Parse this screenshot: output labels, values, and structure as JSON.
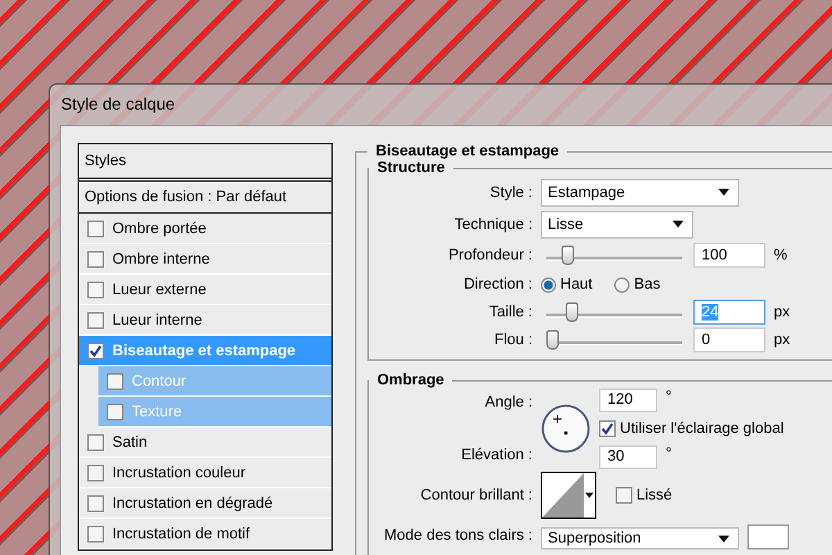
{
  "window": {
    "title": "Style de calque"
  },
  "styles_panel": {
    "header": "Styles",
    "blending_options": "Options de fusion : Par défaut",
    "items": [
      {
        "label": "Ombre portée",
        "checked": false,
        "selected": false
      },
      {
        "label": "Ombre interne",
        "checked": false,
        "selected": false
      },
      {
        "label": "Lueur externe",
        "checked": false,
        "selected": false
      },
      {
        "label": "Lueur interne",
        "checked": false,
        "selected": false
      },
      {
        "label": "Biseautage et estampage",
        "checked": true,
        "selected": true,
        "children": [
          {
            "label": "Contour",
            "checked": false,
            "selected": false
          },
          {
            "label": "Texture",
            "checked": false,
            "selected": false
          }
        ]
      },
      {
        "label": "Satin",
        "checked": false,
        "selected": false
      },
      {
        "label": "Incrustation couleur",
        "checked": false,
        "selected": false
      },
      {
        "label": "Incrustation en dégradé",
        "checked": false,
        "selected": false
      },
      {
        "label": "Incrustation de motif",
        "checked": false,
        "selected": false
      }
    ]
  },
  "section_title": "Biseautage et estampage",
  "structure": {
    "title": "Structure",
    "style": {
      "label": "Style :",
      "value": "Estampage"
    },
    "technique": {
      "label": "Technique :",
      "value": "Lisse"
    },
    "depth": {
      "label": "Profondeur :",
      "level": 0.12,
      "value": "100",
      "unit": "%"
    },
    "direction": {
      "label": "Direction :",
      "options": [
        {
          "label": "Haut",
          "selected": true
        },
        {
          "label": "Bas",
          "selected": false
        }
      ]
    },
    "size": {
      "label": "Taille :",
      "level": 0.16,
      "value": "24",
      "unit": "px",
      "text_selected": true
    },
    "blur": {
      "label": "Flou :",
      "level": 0,
      "value": "0",
      "unit": "px",
      "text_selected": false
    }
  },
  "shading": {
    "title": "Ombrage",
    "angle": {
      "label": "Angle :",
      "value": "120",
      "unit": "°"
    },
    "use_global_light": {
      "label": "Utiliser l'éclairage global",
      "checked": true
    },
    "altitude": {
      "label": "Elévation :",
      "value": "30",
      "unit": "°"
    },
    "gloss_contour": {
      "label": "Contour brillant :"
    },
    "anti_aliased": {
      "label": "Lissé",
      "checked": false
    },
    "highlight_mode": {
      "label": "Mode des tons clairs :",
      "value": "Superposition"
    }
  }
}
